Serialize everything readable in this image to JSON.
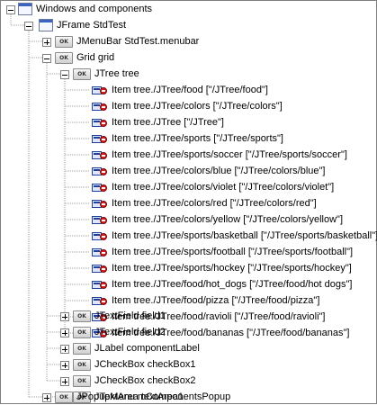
{
  "tree": {
    "root": {
      "label": "Windows and components",
      "icon": "windows-icon"
    },
    "frame": {
      "label": "JFrame StdTest",
      "icon": "jframe-icon"
    },
    "menubar": {
      "label": "JMenuBar StdTest.menubar",
      "icon": "ok-icon"
    },
    "grid": {
      "label": "Grid grid",
      "icon": "ok-icon"
    },
    "jtree": {
      "label": "JTree tree",
      "icon": "ok-icon"
    },
    "items": [
      "Item tree./JTree/food [\"/JTree/food\"]",
      "Item tree./JTree/colors [\"/JTree/colors\"]",
      "Item tree./JTree [\"/JTree\"]",
      "Item tree./JTree/sports [\"/JTree/sports\"]",
      "Item tree./JTree/sports/soccer [\"/JTree/sports/soccer\"]",
      "Item tree./JTree/colors/blue [\"/JTree/colors/blue\"]",
      "Item tree./JTree/colors/violet [\"/JTree/colors/violet\"]",
      "Item tree./JTree/colors/red [\"/JTree/colors/red\"]",
      "Item tree./JTree/colors/yellow [\"/JTree/colors/yellow\"]",
      "Item tree./JTree/sports/basketball [\"/JTree/sports/basketball\"]",
      "Item tree./JTree/sports/football [\"/JTree/sports/football\"]",
      "Item tree./JTree/sports/hockey [\"/JTree/sports/hockey\"]",
      "Item tree./JTree/food/hot_dogs [\"/JTree/food/hot dogs\"]",
      "Item tree./JTree/food/pizza [\"/JTree/food/pizza\"]",
      "Item tree./JTree/food/ravioli [\"/JTree/food/ravioli\"]",
      "Item tree./JTree/food/bananas [\"/JTree/food/bananas\"]"
    ],
    "grid_children": [
      "JTextField field1",
      "JTextField field2",
      "JLabel componentLabel",
      "JCheckBox checkBox1",
      "JCheckBox checkBox2",
      "JTextArea textArea1"
    ],
    "popup": {
      "label": "JPopupMenu mComponentsPopup",
      "icon": "ok-icon"
    },
    "ok_icon_text": "OK"
  }
}
